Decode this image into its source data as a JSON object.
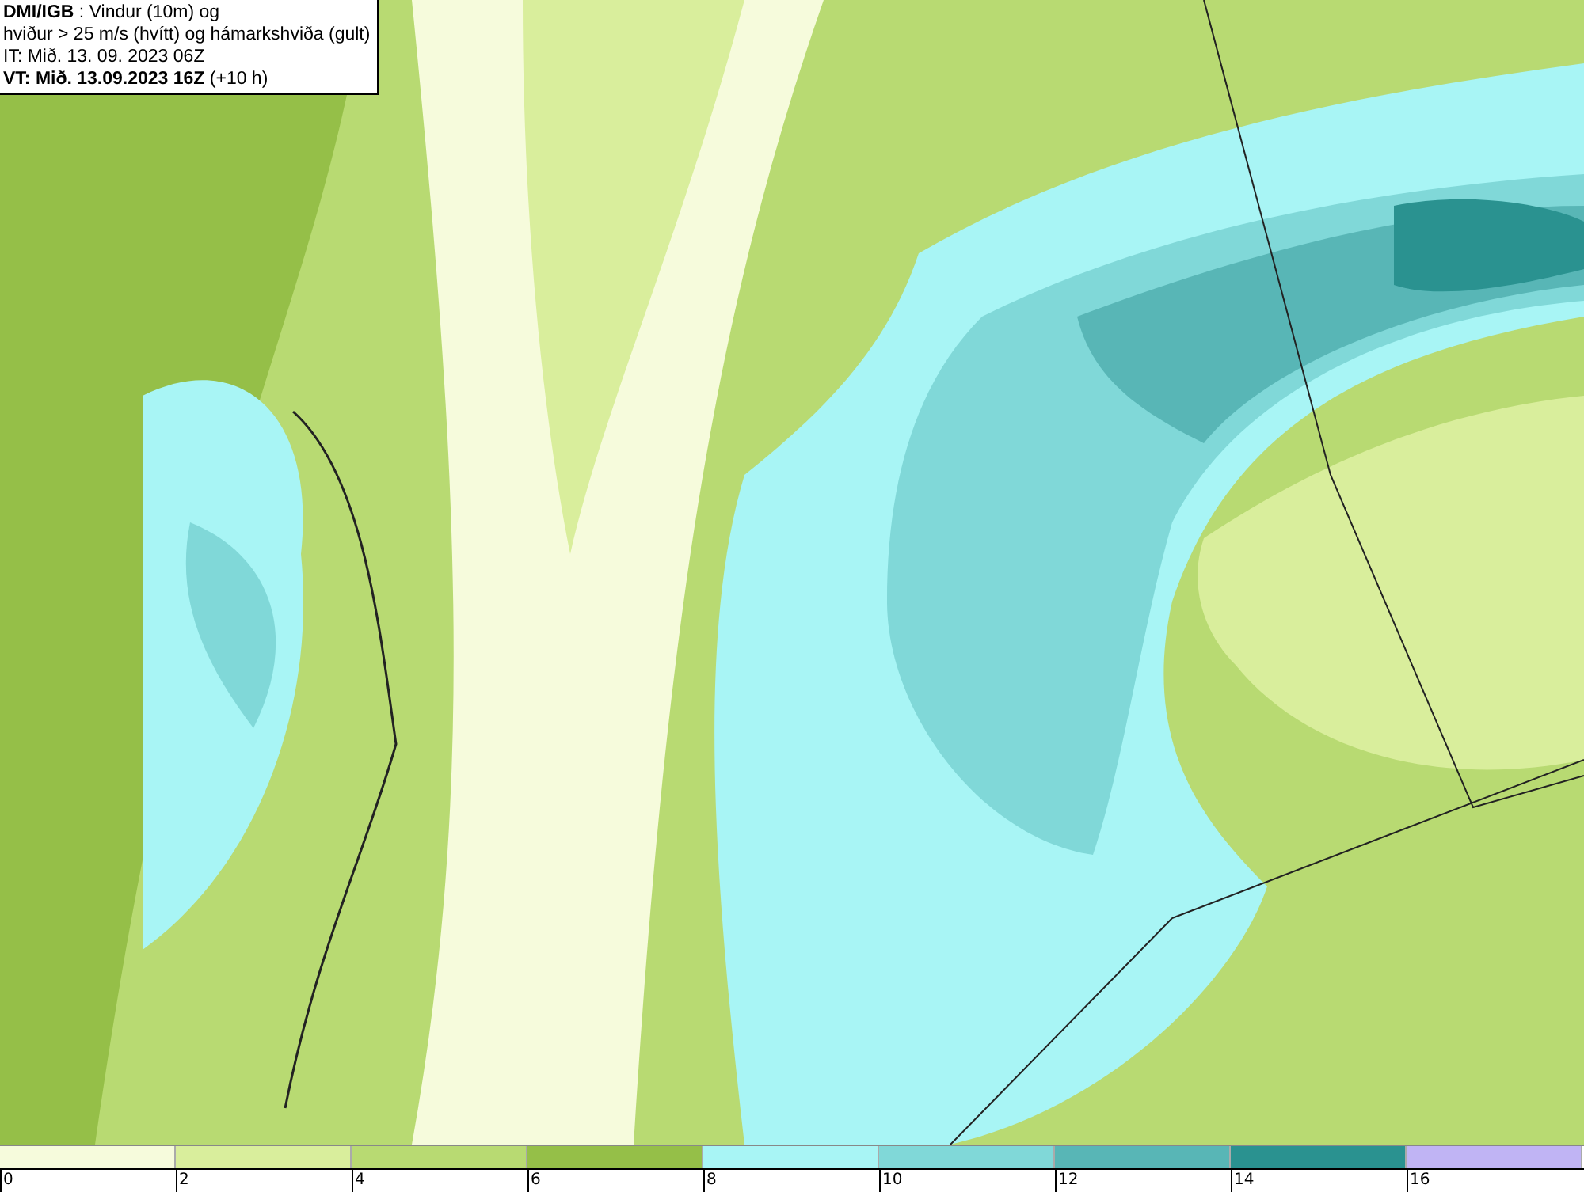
{
  "header": {
    "lines": [
      "**DMI/IGB** : Vindur (10m) og",
      "hviður > 25 m/s (hvítt) og hámarkshviða (gult)",
      "IT: Mið. 13. 09. 2023 06Z",
      "**VT: Mið. 13.09.2023 16Z** (+10 h)"
    ]
  },
  "legend": {
    "segments": [
      {
        "color": "#f6fbdc"
      },
      {
        "color": "#d9ee9c"
      },
      {
        "color": "#b8da72"
      },
      {
        "color": "#95bf48"
      },
      {
        "color": "#a8f5f5"
      },
      {
        "color": "#80d8d8"
      },
      {
        "color": "#58b6b6"
      },
      {
        "color": "#2a9290"
      },
      {
        "color": "#c0b4f4"
      }
    ],
    "ticks": [
      "0",
      "2",
      "4",
      "6",
      "8",
      "10",
      "12",
      "14",
      "16"
    ]
  }
}
